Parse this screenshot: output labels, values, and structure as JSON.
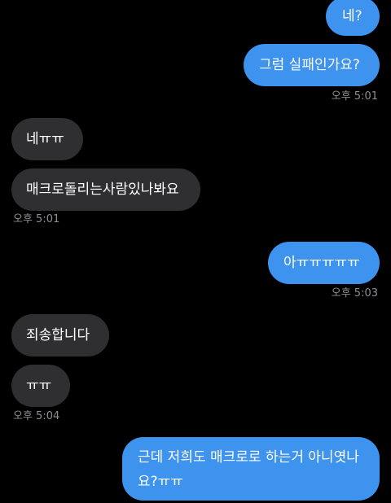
{
  "messages": [
    {
      "id": "m1",
      "direction": "outgoing",
      "text": "네?"
    },
    {
      "id": "m2",
      "direction": "outgoing",
      "text": "그럼 실패인가요?",
      "timestamp": "오후 5:01"
    },
    {
      "id": "m3",
      "direction": "incoming",
      "text": "네ㅠㅠ"
    },
    {
      "id": "m4",
      "direction": "incoming",
      "text": "매크로돌리는사람있나봐요",
      "timestamp": "오후 5:01"
    },
    {
      "id": "m5",
      "direction": "outgoing",
      "text": "아ㅠㅠㅠㅠㅠ",
      "timestamp": "오후 5:03"
    },
    {
      "id": "m6",
      "direction": "incoming",
      "text": "죄송합니다"
    },
    {
      "id": "m7",
      "direction": "incoming",
      "text": "ㅠㅠ",
      "timestamp": "오후 5:04"
    },
    {
      "id": "m8",
      "direction": "outgoing",
      "text": "근데 저희도 매크로로 하는거 아니엿나요?ㅠㅠ"
    }
  ],
  "colors": {
    "outgoing_bubble": "#3d93ee",
    "incoming_bubble": "#2f2f31",
    "background": "#000000",
    "timestamp_text": "#8e8e93"
  }
}
